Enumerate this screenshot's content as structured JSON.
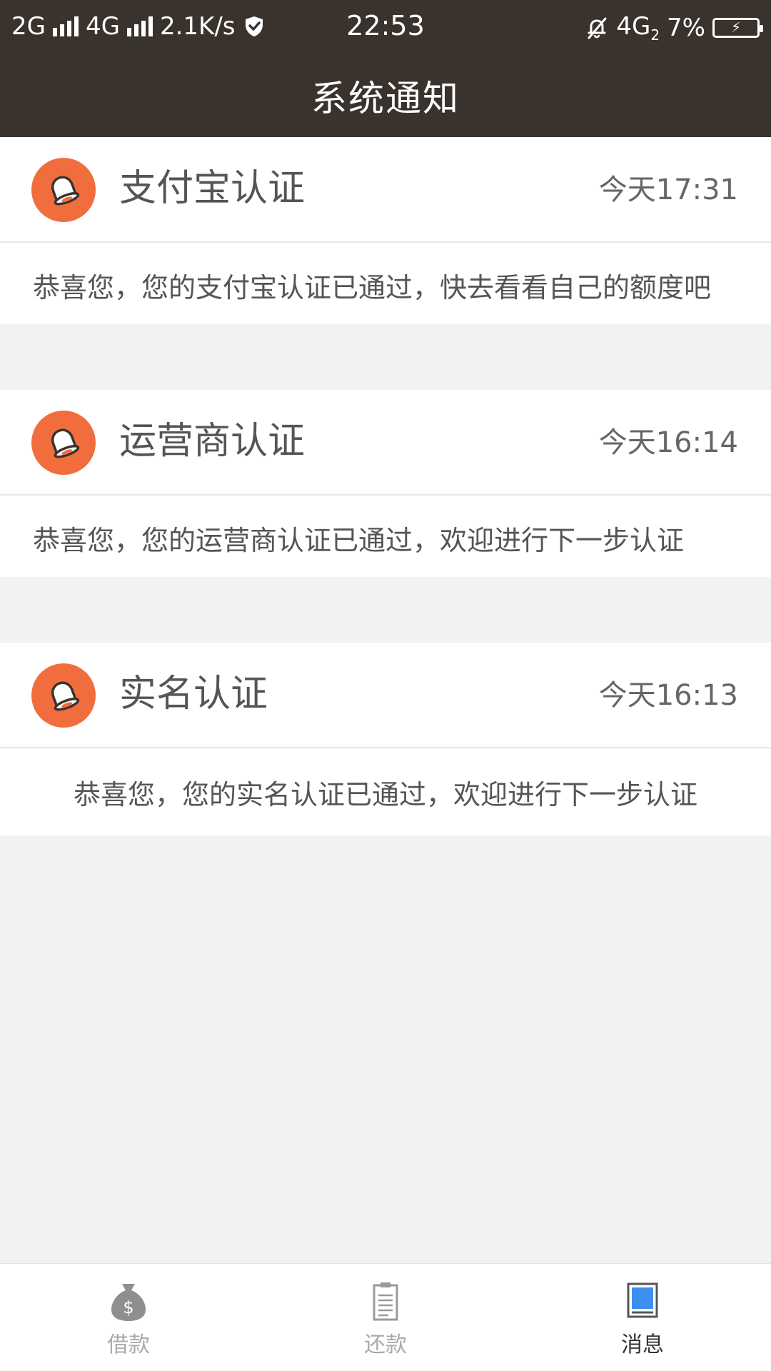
{
  "status_bar": {
    "net1": "2G",
    "net2": "4G",
    "speed": "2.1K/s",
    "time": "22:53",
    "net3": "4G",
    "net3_sub": "2",
    "battery": "7%"
  },
  "header": {
    "title": "系统通知"
  },
  "notifications": [
    {
      "title": "支付宝认证",
      "time": "今天17:31",
      "message": "恭喜您，您的支付宝认证已通过，快去看看自己的额度吧"
    },
    {
      "title": "运营商认证",
      "time": "今天16:14",
      "message": "恭喜您，您的运营商认证已通过，欢迎进行下一步认证"
    },
    {
      "title": "实名认证",
      "time": "今天16:13",
      "message": "恭喜您，您的实名认证已通过，欢迎进行下一步认证"
    }
  ],
  "tabs": [
    {
      "label": "借款",
      "icon": "money-bag-icon",
      "active": false
    },
    {
      "label": "还款",
      "icon": "receipt-icon",
      "active": false
    },
    {
      "label": "消息",
      "icon": "message-icon",
      "active": true
    }
  ],
  "colors": {
    "header_bg": "#3a332d",
    "bell_badge": "#f26d3d",
    "page_bg": "#f1f2f2",
    "active_tab_icon": "#3a8ff0"
  }
}
